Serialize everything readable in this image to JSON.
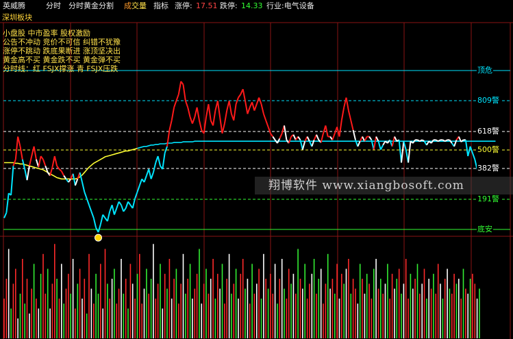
{
  "topbar": {
    "stock_name": "英威腾",
    "menu": [
      "分时",
      "分时黄金分割"
    ],
    "volume_tab": {
      "part1": "成",
      "part2": "交量"
    },
    "indicator": "指标",
    "limit_up_label": "涨停:",
    "limit_up_value": "17.51",
    "limit_down_label": "跌停:",
    "limit_down_value": "14.33",
    "industry": "行业:电气设备"
  },
  "board": "深圳板块",
  "notes": [
    "小盘股 中市盈率 股权激励",
    "公告不冲动 竞价不可信 纠错不犹豫",
    "涨停不跳动 跌底果断进 涨顶坚决出",
    "黄金高不买 黄金跌不买 黄金弹不买",
    "分时线：红 FSJX撑涨  青 FSJX压跌"
  ],
  "levels": {
    "top": "顶危",
    "l809": "809警",
    "l618": "618警",
    "l500": "500警",
    "l382": "382警",
    "l191": "191警",
    "bottom": "底安"
  },
  "watermark": "翔博软件 www.xiangbosoft.com",
  "colors": {
    "background": "#000000",
    "price_up": "#ff1a1a",
    "price_down": "#00e5ff",
    "price_flat": "#ffffff",
    "average": "#ffff33",
    "avg_tail": "#00e5ff",
    "level_top": "#00e5ff",
    "level_mid": "#00e5ff",
    "level_618": "#ffffff",
    "level_500": "#ffff33",
    "level_bottom": "#33ff33",
    "vol_up": "#ff2a2a",
    "vol_down": "#33ee33",
    "vol_flat": "#ffffff",
    "grid": "#8a1414"
  },
  "chart_data": {
    "type": "line",
    "price_series": [
      120,
      128,
      158,
      155,
      200,
      210,
      245,
      230,
      210,
      195,
      178,
      200,
      215,
      230,
      210,
      198,
      215,
      210,
      200,
      190,
      185,
      198,
      215,
      200,
      195,
      192,
      185,
      180,
      175,
      180,
      188,
      170,
      180,
      190,
      175,
      160,
      150,
      140,
      130,
      120,
      105,
      98,
      110,
      125,
      120,
      115,
      130,
      140,
      125,
      135,
      145,
      140,
      130,
      135,
      145,
      140,
      135,
      150,
      160,
      170,
      180,
      175,
      185,
      195,
      180,
      190,
      205,
      215,
      200,
      195,
      220,
      230,
      255,
      270,
      290,
      300,
      310,
      330,
      325,
      300,
      290,
      275,
      265,
      275,
      290,
      270,
      255,
      250,
      275,
      295,
      270,
      262,
      285,
      300,
      275,
      250,
      265,
      285,
      300,
      280,
      270,
      295,
      305,
      310,
      318,
      300,
      280,
      290,
      298,
      285,
      295,
      305,
      295,
      280,
      270,
      260,
      250,
      245,
      240,
      235,
      242,
      250,
      262,
      240,
      235,
      245,
      248,
      240,
      245,
      240,
      225,
      238,
      245,
      238,
      230,
      240,
      248,
      240,
      236,
      250,
      262,
      245,
      245,
      240,
      250,
      260,
      245,
      270,
      290,
      305,
      285,
      270,
      255,
      240,
      230,
      238,
      245,
      238,
      245,
      245,
      240,
      225,
      245,
      238,
      225,
      232,
      238,
      235,
      240,
      230,
      245,
      238,
      240,
      205,
      238,
      225,
      205,
      238,
      235,
      240,
      240,
      238,
      240,
      238,
      232,
      238,
      235,
      240,
      240,
      238,
      240,
      240,
      238,
      240,
      240,
      235,
      230,
      240,
      245,
      237,
      240,
      240,
      215,
      230,
      220,
      210,
      195,
      190
    ],
    "average_series": [
      205,
      205,
      205,
      205,
      205,
      204,
      204,
      203,
      203,
      202,
      201,
      200,
      199,
      198,
      197,
      196,
      195,
      194,
      192,
      190,
      188,
      186,
      184,
      182,
      181,
      180,
      180,
      180,
      180,
      180,
      180,
      180,
      181,
      183,
      186,
      190,
      194,
      198,
      201,
      204,
      206,
      208,
      210,
      212,
      214,
      215,
      216,
      217,
      218,
      219,
      220,
      221,
      222,
      223,
      223,
      224,
      225,
      226,
      227,
      228,
      229,
      230,
      230,
      231,
      232,
      232,
      233,
      233,
      234,
      234,
      234,
      235,
      235,
      235,
      236,
      236,
      236,
      236,
      237,
      237,
      237,
      237,
      237,
      238,
      238,
      238,
      238,
      238,
      238,
      238,
      238,
      238,
      238,
      238,
      238,
      238,
      238,
      238,
      238,
      238,
      238,
      238,
      238,
      238,
      238,
      238,
      238,
      238,
      238,
      238,
      238,
      238,
      238,
      238,
      238,
      238,
      238,
      238,
      238,
      238,
      238,
      238,
      238,
      238,
      238,
      238,
      238,
      238,
      238,
      238,
      238,
      238,
      238,
      238,
      238,
      238,
      238,
      238,
      238,
      238,
      238,
      238,
      238,
      238,
      238,
      238,
      238,
      238,
      238,
      238,
      238,
      238,
      238,
      238,
      238,
      238,
      238,
      238,
      238,
      238,
      238,
      238,
      238,
      238,
      238,
      238,
      238,
      238,
      238,
      238,
      238,
      238,
      238,
      238,
      238,
      238,
      238,
      238,
      238,
      238,
      238,
      238,
      238,
      238,
      238,
      238,
      238,
      238,
      238,
      238,
      238,
      238,
      238,
      238,
      238,
      238,
      238,
      238,
      238,
      238,
      238,
      238,
      238,
      238,
      238,
      238,
      238,
      238,
      238,
      238,
      238,
      238,
      238,
      238,
      238
    ],
    "volume_series": [
      40,
      60,
      90,
      30,
      55,
      70,
      20,
      45,
      80,
      35,
      60,
      25,
      50,
      75,
      40,
      30,
      65,
      85,
      45,
      70,
      30,
      55,
      95,
      60,
      40,
      75,
      35,
      50,
      65,
      45,
      80,
      30,
      55,
      70,
      40,
      60,
      25,
      85,
      50,
      35,
      65,
      45,
      75,
      30,
      90,
      55,
      40,
      60,
      70,
      35,
      50,
      80,
      45,
      60,
      30,
      75,
      55,
      40,
      65,
      85,
      35,
      50,
      70,
      45,
      60,
      95,
      40,
      55,
      75,
      30,
      65,
      50,
      80,
      40,
      60,
      70,
      35,
      55,
      85,
      45,
      60,
      75,
      40,
      50,
      65,
      90,
      35,
      55,
      70,
      45,
      60,
      80,
      40,
      65,
      50,
      75,
      35,
      60,
      85,
      45,
      55,
      70,
      40,
      65,
      80,
      50,
      60,
      35,
      75,
      45,
      55,
      70,
      40,
      85,
      60,
      50,
      65,
      45,
      75,
      35,
      60,
      80,
      50,
      40,
      70,
      55,
      65,
      45,
      90,
      60,
      50,
      75,
      40,
      55,
      65,
      80,
      45,
      60,
      70,
      35,
      55,
      85,
      50,
      60,
      45,
      75,
      40,
      65,
      55,
      70,
      80,
      45,
      60,
      50,
      35,
      75,
      60,
      45,
      65,
      55,
      40,
      70,
      80,
      50,
      60,
      45,
      55,
      75,
      40,
      65,
      50,
      60,
      70,
      45,
      55,
      80,
      40,
      65,
      50,
      60,
      75,
      45,
      55,
      70,
      40,
      60,
      50,
      65,
      45,
      75,
      55,
      40,
      60,
      70,
      50,
      45,
      65,
      55,
      60,
      40,
      70,
      50,
      45,
      60,
      65,
      55,
      40,
      50
    ],
    "volume_direction": [
      1,
      1,
      0,
      -1,
      1,
      1,
      0,
      -1,
      1,
      -1,
      1,
      0,
      1,
      -1,
      1,
      0,
      -1,
      1,
      1,
      -1,
      0,
      1,
      1,
      -1,
      1,
      0,
      -1,
      1,
      1,
      -1,
      0,
      1,
      -1,
      1,
      0,
      1,
      -1,
      1,
      0,
      1,
      -1,
      -1,
      1,
      0,
      1,
      -1,
      1,
      0,
      -1,
      1,
      1,
      0,
      -1,
      1,
      -1,
      1,
      0,
      1,
      -1,
      1,
      1,
      0,
      -1,
      1,
      -1,
      0,
      1,
      1,
      -1,
      0,
      1,
      -1,
      1,
      0,
      1,
      -1,
      1,
      1,
      0,
      -1,
      1,
      -1,
      0,
      1,
      1,
      -1,
      0,
      1,
      -1,
      1,
      0,
      1,
      -1,
      1,
      0,
      -1,
      1,
      1,
      0,
      -1,
      1,
      -1,
      0,
      1,
      1,
      -1,
      0,
      1,
      -1,
      1,
      0,
      1,
      -1,
      0,
      1,
      -1,
      1,
      1,
      0,
      -1,
      1,
      0,
      -1,
      1,
      1,
      -1,
      0,
      1,
      -1,
      1,
      0,
      -1,
      1,
      1,
      0,
      -1,
      1,
      -1,
      0,
      1,
      1,
      -1,
      0,
      1,
      -1,
      1,
      0,
      1,
      -1,
      0,
      1,
      -1,
      1,
      1,
      0,
      -1,
      1,
      0,
      -1,
      1,
      1,
      -1,
      0,
      1,
      -1,
      1,
      0,
      -1,
      1,
      1,
      0,
      -1,
      1,
      -1,
      0,
      1,
      1,
      -1,
      0,
      1,
      -1,
      1,
      0,
      1,
      -1,
      0,
      1,
      -1,
      1,
      1,
      0,
      -1,
      1,
      0,
      -1,
      1,
      1,
      -1,
      0,
      1,
      -1,
      1,
      0,
      -1,
      1,
      1,
      0,
      -1,
      1,
      -1
    ]
  }
}
